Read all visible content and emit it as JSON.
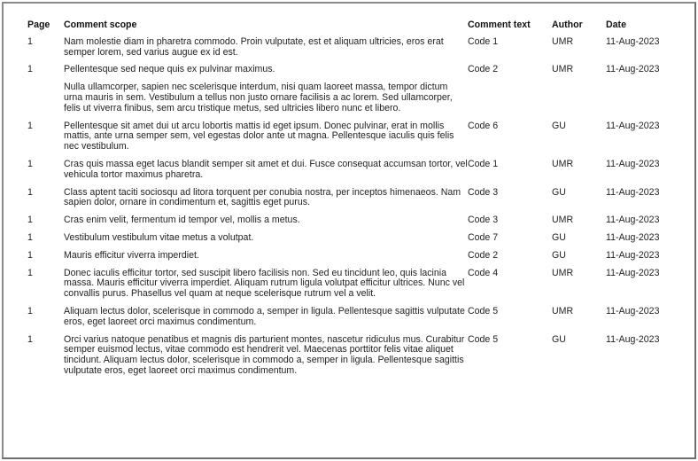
{
  "table": {
    "headers": {
      "page": "Page",
      "scope": "Comment scope",
      "text": "Comment text",
      "author": "Author",
      "date": "Date"
    },
    "rows": [
      {
        "page": "1",
        "scope": [
          "Nam molestie diam in pharetra commodo. Proin vulputate, est et aliquam ultricies, eros erat semper lorem, sed varius augue ex id est."
        ],
        "text": "Code 1",
        "author": "UMR",
        "date": "11-Aug-2023"
      },
      {
        "page": "1",
        "scope": [
          "Pellentesque sed neque quis ex pulvinar maximus.",
          "Nulla ullamcorper, sapien nec scelerisque interdum, nisi quam laoreet massa, tempor dictum urna mauris in sem. Vestibulum a tellus non justo ornare facilisis a ac lorem. Sed ullamcorper, felis ut viverra finibus, sem arcu tristique metus, sed ultricies libero nunc et libero."
        ],
        "text": "Code 2",
        "author": "UMR",
        "date": "11-Aug-2023"
      },
      {
        "page": "1",
        "scope": [
          "Pellentesque sit amet dui ut arcu lobortis mattis id eget ipsum. Donec pulvinar, erat in mollis mattis, ante urna semper sem, vel egestas dolor ante ut magna. Pellentesque iaculis quis felis nec vestibulum."
        ],
        "text": "Code 6",
        "author": "GU",
        "date": "11-Aug-2023"
      },
      {
        "page": "1",
        "scope": [
          "Cras quis massa eget lacus blandit semper sit amet et dui. Fusce consequat accumsan tortor, vel vehicula tortor maximus pharetra."
        ],
        "text": "Code 1",
        "author": "UMR",
        "date": "11-Aug-2023"
      },
      {
        "page": "1",
        "scope": [
          "Class aptent taciti sociosqu ad litora torquent per conubia nostra, per inceptos himenaeos. Nam sapien dolor, ornare in condimentum et, sagittis eget purus."
        ],
        "text": "Code 3",
        "author": "GU",
        "date": "11-Aug-2023"
      },
      {
        "page": "1",
        "scope": [
          "Cras enim velit, fermentum id tempor vel, mollis a metus."
        ],
        "text": "Code 3",
        "author": "UMR",
        "date": "11-Aug-2023"
      },
      {
        "page": "1",
        "scope": [
          "Vestibulum vestibulum vitae metus a volutpat."
        ],
        "text": "Code 7",
        "author": "GU",
        "date": "11-Aug-2023"
      },
      {
        "page": "1",
        "scope": [
          "Mauris efficitur viverra imperdiet."
        ],
        "text": "Code 2",
        "author": "GU",
        "date": "11-Aug-2023"
      },
      {
        "page": "1",
        "scope": [
          "Donec iaculis efficitur tortor, sed suscipit libero facilisis non. Sed eu tincidunt leo, quis lacinia massa. Mauris efficitur viverra imperdiet. Aliquam rutrum ligula volutpat efficitur ultrices. Nunc vel convallis purus. Phasellus vel quam at neque scelerisque rutrum vel a velit."
        ],
        "text": "Code 4",
        "author": "UMR",
        "date": "11-Aug-2023"
      },
      {
        "page": "1",
        "scope": [
          "Aliquam lectus dolor, scelerisque in commodo a, semper in ligula. Pellentesque sagittis vulputate eros, eget laoreet orci maximus condimentum."
        ],
        "text": "Code 5",
        "author": "UMR",
        "date": "11-Aug-2023"
      },
      {
        "page": "1",
        "scope": [
          "Orci varius natoque penatibus et magnis dis parturient montes, nascetur ridiculus mus. Curabitur semper euismod lectus, vitae commodo est hendrerit vel. Maecenas porttitor felis vitae aliquet tincidunt. Aliquam lectus dolor, scelerisque in commodo a, semper in ligula. Pellentesque sagittis vulputate eros, eget laoreet orci maximus condimentum."
        ],
        "text": "Code 5",
        "author": "GU",
        "date": "11-Aug-2023"
      }
    ]
  }
}
